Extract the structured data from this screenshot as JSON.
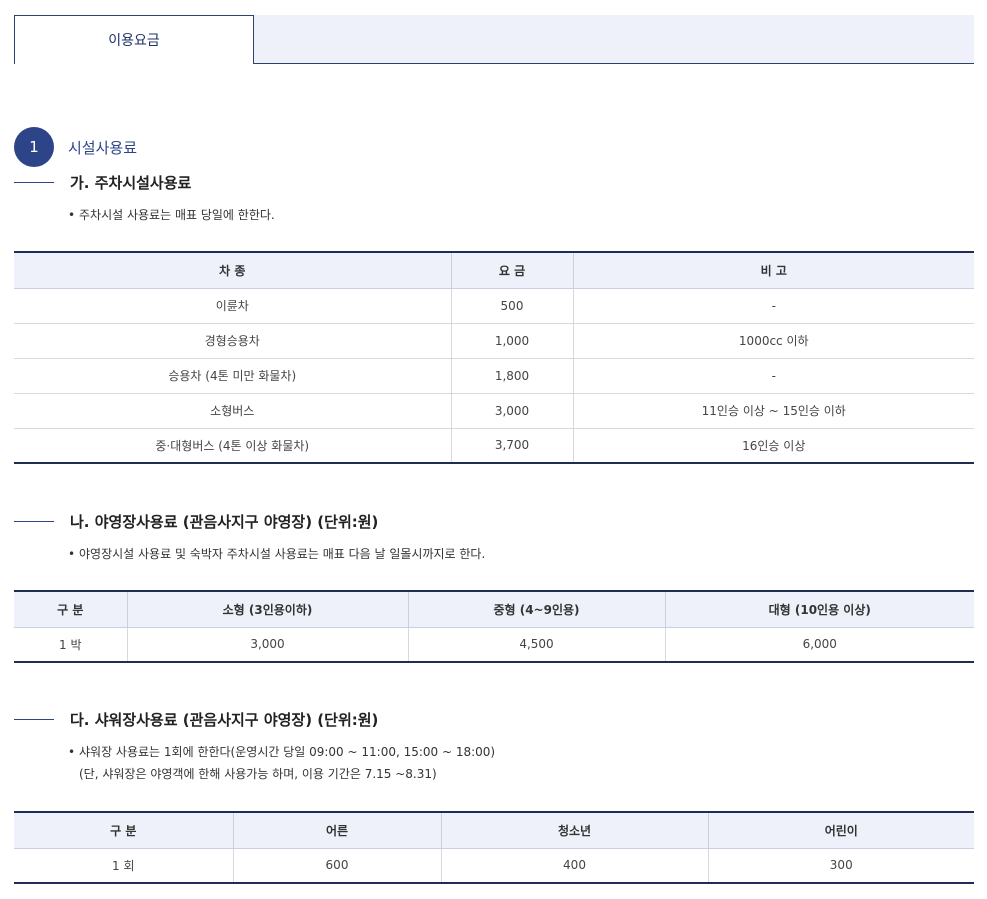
{
  "tabs": {
    "active": "이용요금"
  },
  "section": {
    "number": "1",
    "title": "시설사용료"
  },
  "parking": {
    "title": "가. 주차시설사용료",
    "note": "주차시설 사용료는 매표 당일에 한한다.",
    "headers": [
      "차 종",
      "요 금",
      "비 고"
    ],
    "rows": [
      [
        "이륜차",
        "500",
        "-"
      ],
      [
        "경형승용차",
        "1,000",
        "1000cc 이하"
      ],
      [
        "승용차 (4톤 미만 화물차)",
        "1,800",
        "-"
      ],
      [
        "소형버스",
        "3,000",
        "11인승 이상 ~ 15인승 이하"
      ],
      [
        "중·대형버스 (4톤 이상 화물차)",
        "3,700",
        "16인승 이상"
      ]
    ]
  },
  "camping": {
    "title": "나. 야영장사용료 (관음사지구 야영장) (단위:원)",
    "note": "야영장시설 사용료 및 숙박자 주차시설 사용료는 매표 다음 날 일몰시까지로 한다.",
    "headers": [
      "구 분",
      "소형 (3인용이하)",
      "중형 (4~9인용)",
      "대형 (10인용 이상)"
    ],
    "rows": [
      [
        "1 박",
        "3,000",
        "4,500",
        "6,000"
      ]
    ]
  },
  "shower": {
    "title": "다. 샤워장사용료 (관음사지구 야영장) (단위:원)",
    "note1": "샤워장 사용료는 1회에 한한다(운영시간 당일 09:00 ~ 11:00, 15:00 ~ 18:00)",
    "note2": "(단, 샤워장은 야영객에 한해 사용가능 하며, 이용 기간은 7.15 ~8.31)",
    "headers": [
      "구 분",
      "어른",
      "청소년",
      "어린이"
    ],
    "rows": [
      [
        "1 회",
        "600",
        "400",
        "300"
      ]
    ]
  }
}
